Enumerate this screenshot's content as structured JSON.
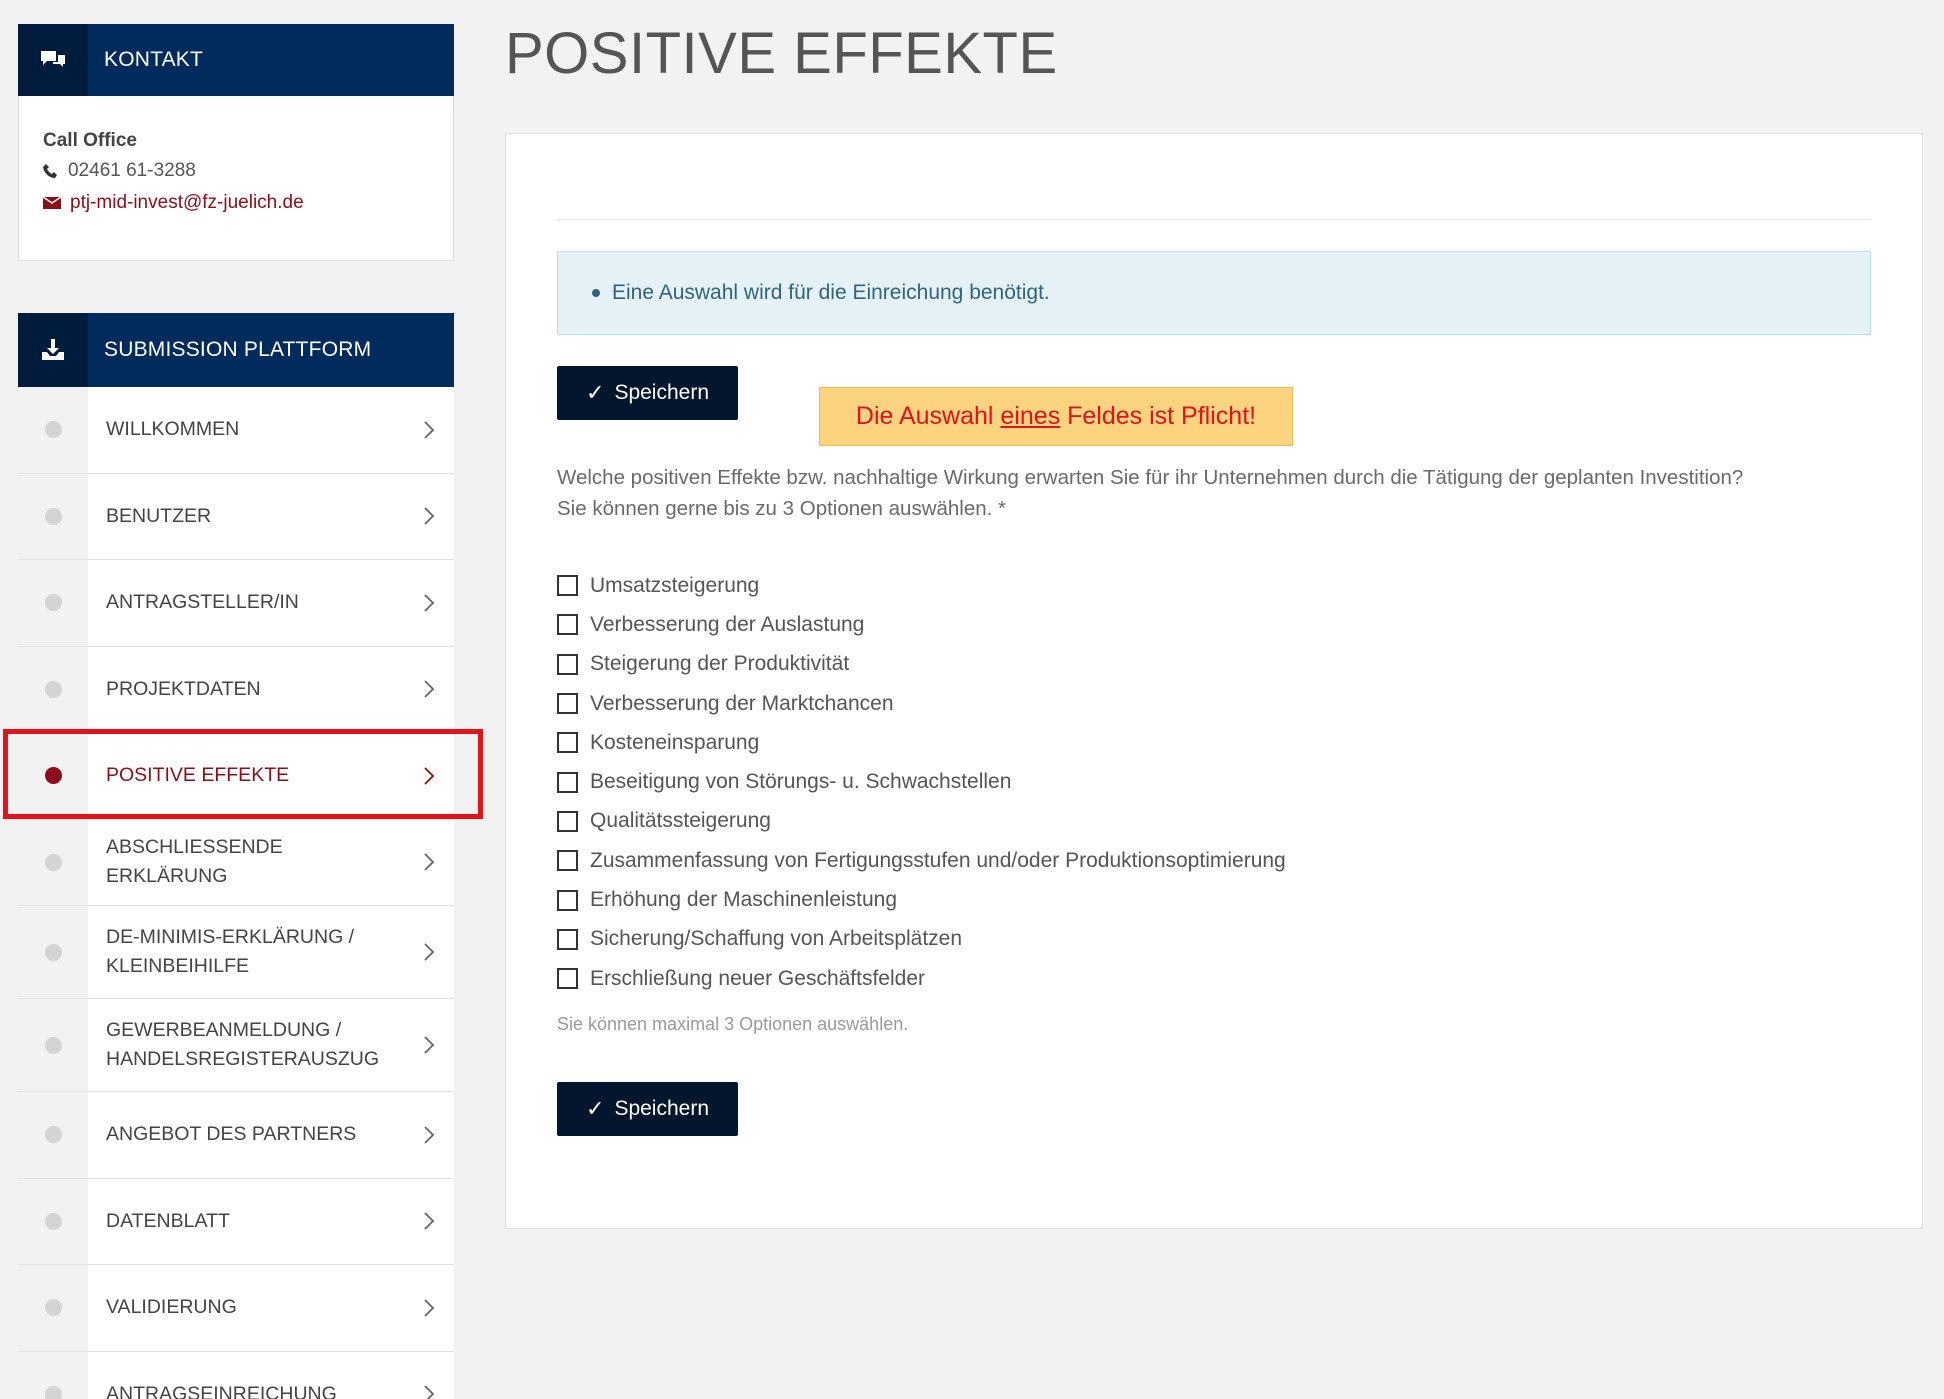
{
  "kontakt": {
    "title": "KONTAKT",
    "office": "Call Office",
    "phone": "02461 61-3288",
    "email": "ptj-mid-invest@fz-juelich.de"
  },
  "submission": {
    "title": "SUBMISSION PLATTFORM",
    "items": [
      {
        "label": "WILLKOMMEN"
      },
      {
        "label": "BENUTZER"
      },
      {
        "label": "ANTRAGSTELLER/IN"
      },
      {
        "label": "PROJEKTDATEN"
      },
      {
        "label": "POSITIVE EFFEKTE",
        "active": true
      },
      {
        "label": "ABSCHLIESSENDE ERKLÄRUNG"
      },
      {
        "label": "DE-MINIMIS-ERKLÄRUNG / KLEINBEIHILFE"
      },
      {
        "label": "GEWERBEANMELDUNG / HANDELSREGISTERAUSZUG"
      },
      {
        "label": "ANGEBOT DES PARTNERS"
      },
      {
        "label": "DATENBLATT"
      },
      {
        "label": "VALIDIERUNG"
      },
      {
        "label": "ANTRAGSEINREICHUNG"
      }
    ]
  },
  "main": {
    "title": "POSITIVE EFFEKTE",
    "alert": "Eine Auswahl wird für die Einreichung benötigt.",
    "save_label": "Speichern",
    "callout": {
      "before": "Die Auswahl ",
      "underlined": "eines",
      "after": " Feldes ist Pflicht!"
    },
    "question_line1": "Welche positiven Effekte bzw. nachhaltige Wirkung erwarten Sie für ihr Unternehmen durch die Tätigung der geplanten Investition?",
    "question_line2": "Sie können gerne bis zu 3 Optionen auswählen. *",
    "options": [
      "Umsatzsteigerung",
      "Verbesserung der Auslastung",
      "Steigerung der Produktivität",
      "Verbesserung der Marktchancen",
      "Kosteneinsparung",
      "Beseitigung von Störungs- u. Schwachstellen",
      "Qualitätssteigerung",
      "Zusammenfassung von Fertigungsstufen und/oder Produktionsoptimierung",
      "Erhöhung der Maschinenleistung",
      "Sicherung/Schaffung von Arbeitsplätzen",
      "Erschließung neuer Geschäftsfelder"
    ],
    "hint": "Sie können maximal 3 Optionen auswählen."
  },
  "colors": {
    "navy": "#002b5c",
    "accent_red": "#8b0e1a",
    "highlight_red": "#e3121b",
    "callout_bg": "#fcd37f"
  }
}
